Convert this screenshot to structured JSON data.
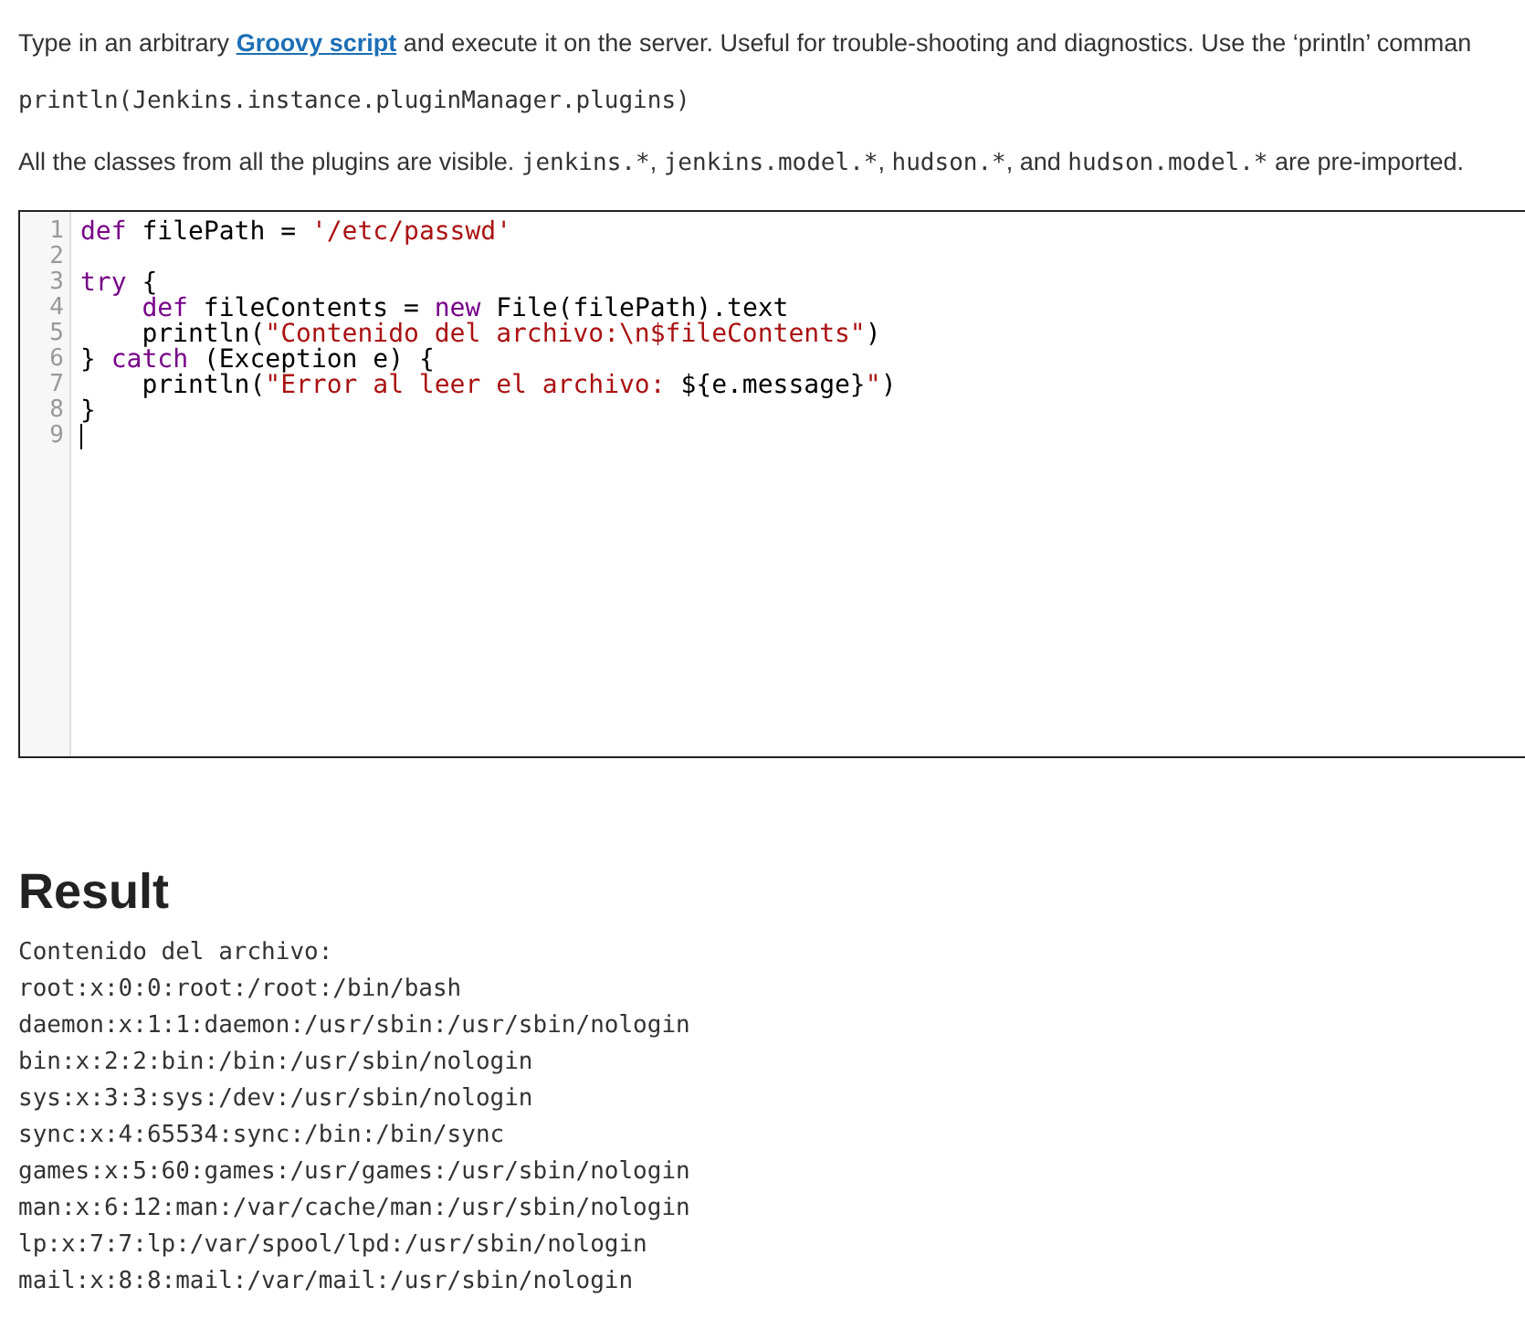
{
  "intro": {
    "before": "Type in an arbitrary ",
    "link": "Groovy script",
    "after": " and execute it on the server. Useful for trouble-shooting and diagnostics. Use the ‘println’ comman"
  },
  "example": "println(Jenkins.instance.pluginManager.plugins)",
  "imports_note": {
    "lead": "All the classes from all the plugins are visible. ",
    "parts": [
      {
        "code": "jenkins.*",
        "after": ", "
      },
      {
        "code": "jenkins.model.*",
        "after": ", "
      },
      {
        "code": "hudson.*",
        "after": ", and "
      },
      {
        "code": "hudson.model.*",
        "after": " are pre-imported."
      }
    ]
  },
  "editor": {
    "lines": [
      {
        "number": "1",
        "tokens": [
          {
            "kind": "keyword",
            "text": "def"
          },
          {
            "kind": "plain",
            "text": " filePath = "
          },
          {
            "kind": "string",
            "text": "'/etc/passwd'"
          }
        ]
      },
      {
        "number": "2"
      },
      {
        "number": "3",
        "tokens": [
          {
            "kind": "keyword",
            "text": "try"
          },
          {
            "kind": "plain",
            "text": " {"
          }
        ]
      },
      {
        "number": "4",
        "indent": true,
        "tokens": [
          {
            "kind": "keyword",
            "text": "def"
          },
          {
            "kind": "plain",
            "text": " fileContents = "
          },
          {
            "kind": "keyword",
            "text": "new"
          },
          {
            "kind": "plain",
            "text": " File(filePath).text"
          }
        ]
      },
      {
        "number": "5",
        "indent": true,
        "tokens": [
          {
            "kind": "plain",
            "text": "println("
          },
          {
            "kind": "string",
            "text": "\"Contenido del archivo:\\n$fileContents\""
          },
          {
            "kind": "plain",
            "text": ")"
          }
        ]
      },
      {
        "number": "6",
        "tokens": [
          {
            "kind": "plain",
            "text": "} "
          },
          {
            "kind": "keyword",
            "text": "catch"
          },
          {
            "kind": "plain",
            "text": " (Exception e) {"
          }
        ]
      },
      {
        "number": "7",
        "indent": true,
        "tokens": [
          {
            "kind": "plain",
            "text": "println("
          },
          {
            "kind": "string",
            "text": "\"Error al leer el archivo: "
          },
          {
            "kind": "plain",
            "text": "${e.message}"
          },
          {
            "kind": "string",
            "text": "\""
          },
          {
            "kind": "plain",
            "text": ")"
          }
        ]
      },
      {
        "number": "8",
        "tokens": [
          {
            "kind": "plain",
            "text": "}"
          }
        ]
      },
      {
        "number": "9",
        "cursor": true
      }
    ]
  },
  "result": {
    "heading": "Result",
    "lines": [
      "Contenido del archivo:",
      "root:x:0:0:root:/root:/bin/bash",
      "daemon:x:1:1:daemon:/usr/sbin:/usr/sbin/nologin",
      "bin:x:2:2:bin:/bin:/usr/sbin/nologin",
      "sys:x:3:3:sys:/dev:/usr/sbin/nologin",
      "sync:x:4:65534:sync:/bin:/bin/sync",
      "games:x:5:60:games:/usr/games:/usr/sbin/nologin",
      "man:x:6:12:man:/var/cache/man:/usr/sbin/nologin",
      "lp:x:7:7:lp:/var/spool/lpd:/usr/sbin/nologin",
      "mail:x:8:8:mail:/var/mail:/usr/sbin/nologin"
    ]
  }
}
